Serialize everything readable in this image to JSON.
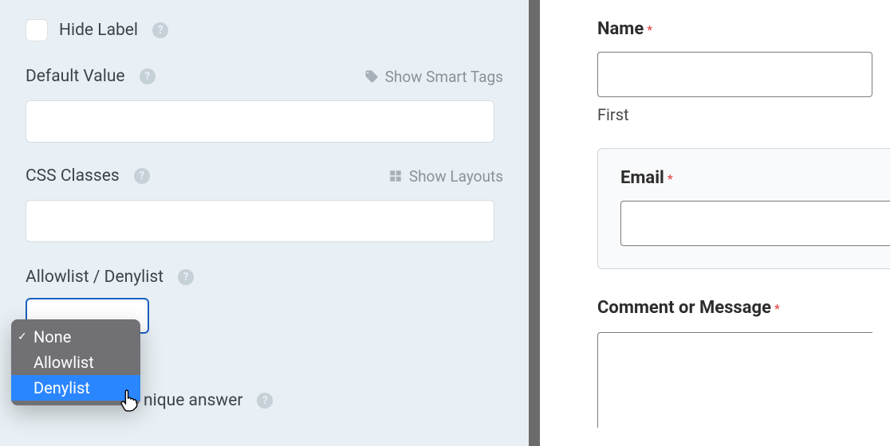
{
  "left": {
    "hide_label": "Hide Label",
    "default_value": "Default Value",
    "show_smart_tags": "Show Smart Tags",
    "default_value_input": "",
    "css_classes": "CSS Classes",
    "show_layouts": "Show Layouts",
    "css_classes_input": "",
    "allow_label": "Allowlist / Denylist",
    "unique_suffix": "nique answer",
    "popup": {
      "none": "None",
      "allowlist": "Allowlist",
      "denylist": "Denylist"
    }
  },
  "right": {
    "name_label": "Name",
    "first": "First",
    "email_label": "Email",
    "comment_label": "Comment or Message",
    "asterisk": "*"
  }
}
